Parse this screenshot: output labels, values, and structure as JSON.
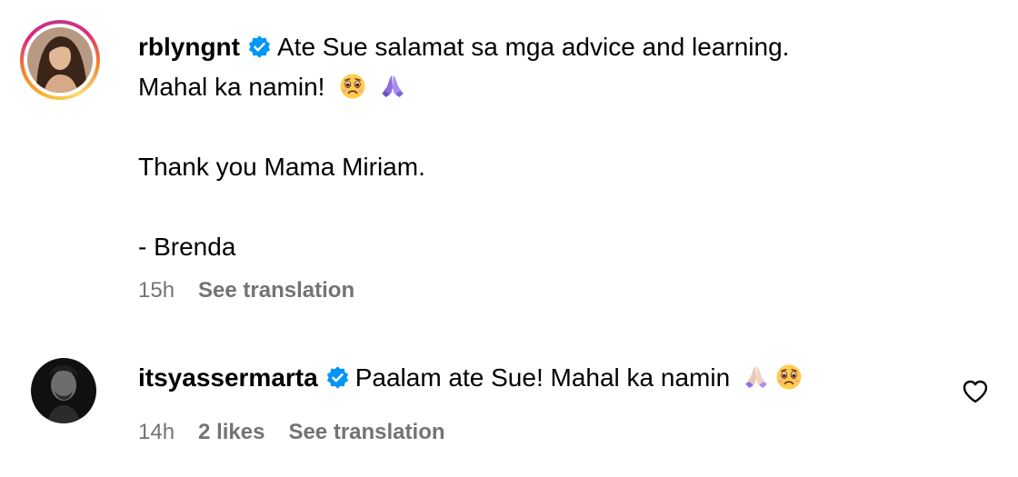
{
  "comments": [
    {
      "username": "rblyngnt",
      "verified": true,
      "avatar_ring": true,
      "text_line1": "Ate Sue salamat sa mga advice and learning.",
      "text_line2": "Mahal ka namin!",
      "text_line2_emojis": [
        "crying-face-emoji",
        "praying-hands-emoji"
      ],
      "text_line3": "Thank you Mama Miriam.",
      "text_line4": "- Brenda",
      "time": "15h",
      "see_translation": "See translation"
    },
    {
      "username": "itsyassermarta",
      "verified": true,
      "avatar_ring": false,
      "text": "Paalam ate Sue! Mahal ka namin",
      "text_emojis": [
        "praying-hands-emoji",
        "crying-face-emoji"
      ],
      "time": "14h",
      "likes": "2 likes",
      "see_translation": "See translation"
    }
  ],
  "colors": {
    "verified_blue": "#0095f6",
    "meta_gray": "#737373",
    "text": "#000000"
  },
  "icons": [
    "verified-badge-icon",
    "heart-icon"
  ]
}
